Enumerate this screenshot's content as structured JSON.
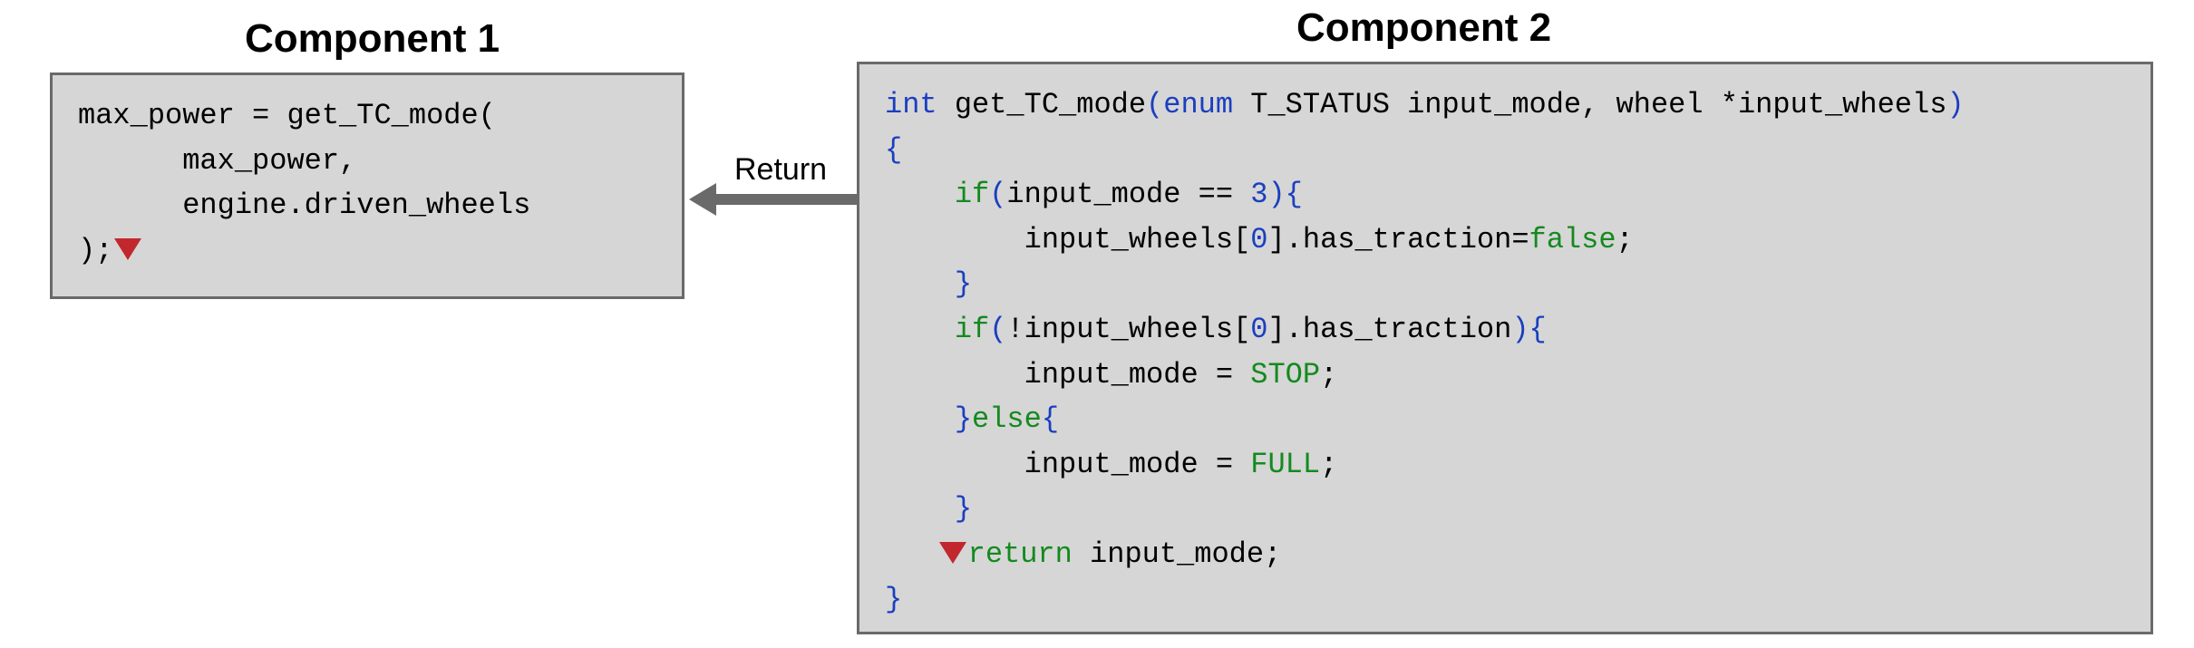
{
  "component1": {
    "title": "Component 1",
    "code": {
      "l1": "max_power = get_TC_mode(",
      "l2": "      max_power,",
      "l3": "      engine.driven_wheels",
      "l4_prefix": ");"
    }
  },
  "arrow": {
    "label": "Return"
  },
  "component2": {
    "title": "Component 2",
    "code": {
      "sig_int": "int",
      "sig_name": " get_TC_mode",
      "sig_open": "(",
      "sig_enum": "enum",
      "sig_params": " T_STATUS input_mode, wheel *input_wheels",
      "sig_close": ")",
      "open_brace": "{",
      "if1_kw": "if",
      "if1_cond_open": "(",
      "if1_cond": "input_mode == ",
      "if1_num": "3",
      "if1_cond_close": "){",
      "if1_body": "        input_wheels[",
      "if1_idx": "0",
      "if1_body2": "].has_traction=",
      "if1_false": "false",
      "if1_semi": ";",
      "if1_close": "    }",
      "if2_kw": "if",
      "if2_cond_open": "(",
      "if2_cond": "!input_wheels[",
      "if2_idx": "0",
      "if2_cond2": "].has_traction",
      "if2_cond_close": "){",
      "if2_body": "        input_mode = ",
      "if2_val": "STOP",
      "if2_semi": ";",
      "else_close": "    }",
      "else_kw": "else",
      "else_open": "{",
      "else_body": "        input_mode = ",
      "else_val": "FULL",
      "else_semi": ";",
      "block_close": "    }",
      "ret_kw": "return",
      "ret_expr": " input_mode;",
      "close_brace": "}"
    }
  }
}
